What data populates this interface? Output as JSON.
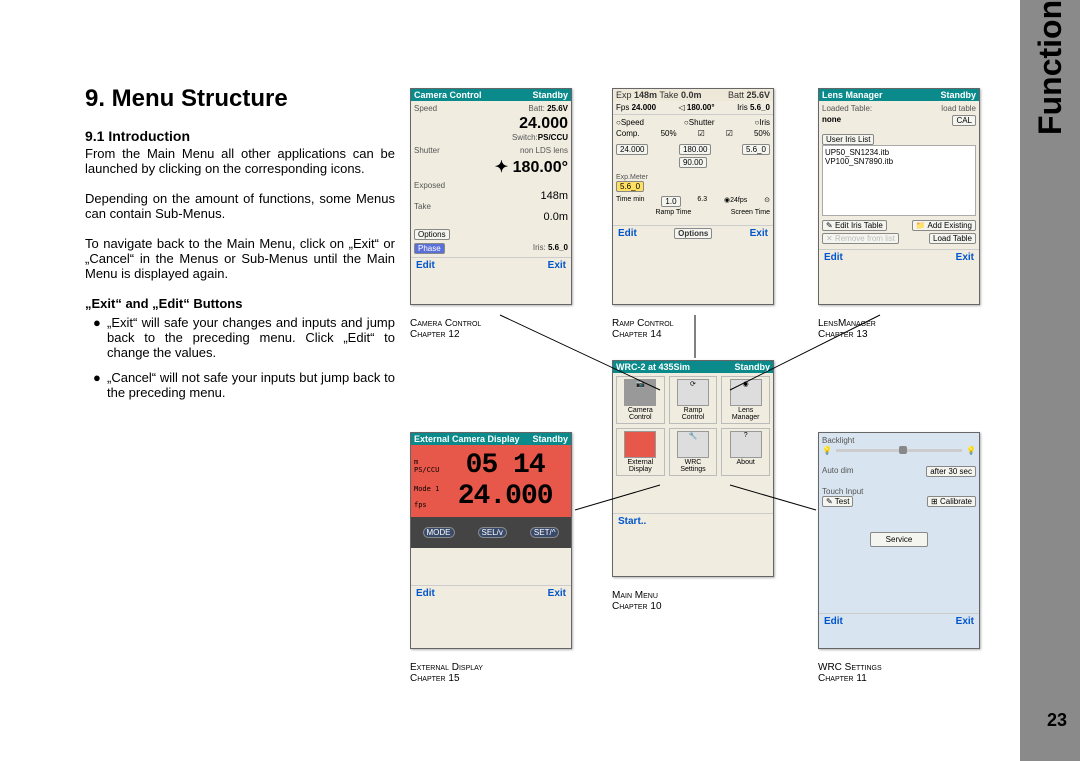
{
  "tab_label": "Functions",
  "page_number": "23",
  "heading": "9. Menu Structure",
  "sub_heading": "9.1 Introduction",
  "p1": "From the Main Menu all other applications can be launched by clicking on the corresponding icons.",
  "p2": "Depending on the amount of functions, some Menus can contain Sub-Menus.",
  "p3": "To navigate back to the Main Menu, click on „Exit“ or „Cancel“ in the Menus or Sub-Menus until the Main Menu is displayed again.",
  "sub2": "„Exit“ and „Edit“ Buttons",
  "b1": "„Exit“ will  safe your changes and inputs and jump back to the preceding menu. Click „Edit“ to change the values.",
  "b2": "„Cancel“ will not safe your inputs but jump back to the preceding menu.",
  "cam": {
    "title": "Camera Control",
    "status": "Standby",
    "speed": "Speed",
    "speed_v": "24.000",
    "batt": "Batt:",
    "batt_v": "25.6V",
    "switch": "Switch:",
    "switch_v": "PS/CCU",
    "shutter": "Shutter",
    "shutter_v": "180.00°",
    "lds": "non LDS lens",
    "exposed": "Exposed",
    "exp_v": "148m",
    "take": "Take",
    "take_v": "0.0m",
    "options": "Options",
    "phase": "Phase",
    "iris": "Iris:",
    "iris_v": "5.6_0",
    "edit": "Edit",
    "exit": "Exit",
    "cap1": "Camera Control",
    "cap2": "Chapter 12"
  },
  "ramp": {
    "title_l": "Exp",
    "v1": "148m",
    "title_m": "Take",
    "v2": "0.0m",
    "title_r": "Batt",
    "v3": "25.6V",
    "fps": "Fps",
    "fps_v": "24.000",
    "ang": "180.00°",
    "iris": "Iris",
    "iris_v": "5.6_0",
    "speed": "Speed",
    "shutter": "Shutter",
    "iris2": "Iris",
    "comp": "Comp.",
    "comp_v": "50%",
    "comp2": "50%",
    "r1": "24.000",
    "r2": "180.00",
    "r3": "5.6_0",
    "r4": "90.00",
    "exp_m": "Exp.Meter",
    "exp_mv": "5.6_0",
    "tmin": "Time min",
    "tv": "1.0",
    "rv": "6.3",
    "fv": "24fps",
    "rt": "Ramp Time",
    "st": "Screen Time",
    "edit": "Edit",
    "opt": "Options",
    "exit": "Exit",
    "cap1": "Ramp Control",
    "cap2": "Chapter 14"
  },
  "lens": {
    "title": "Lens Manager",
    "status": "Standby",
    "lt": "Loaded Table:",
    "none": "none",
    "load": "load table",
    "cal": "CAL",
    "uil": "User Iris List",
    "f1": "UP50_SN1234.itb",
    "f2": "VP100_SN7890.itb",
    "b1": "Edit Iris Table",
    "b2": "Add Existing",
    "b3": "Remove from list",
    "b4": "Load Table",
    "edit": "Edit",
    "exit": "Exit",
    "cap1": "LensManager",
    "cap2": "Chapter 13"
  },
  "main": {
    "title": "WRC-2 at 435Sim",
    "status": "Standby",
    "c1": "Camera Control",
    "c2": "Ramp Control",
    "c3": "Lens Manager",
    "c4": "External Display",
    "c5": "WRC Settings",
    "c6": "About",
    "start": "Start..",
    "cap1": "Main Menu",
    "cap2": "Chapter 10"
  },
  "ext": {
    "title": "External Camera Display",
    "status": "Standby",
    "m": "m",
    "ps": "PS/CCU",
    "mode1": "Mode 1",
    "fps": "fps",
    "d1": "05 14",
    "d2": "24.000",
    "b1": "MODE",
    "b2": "SEL/v",
    "b3": "SET/^",
    "edit": "Edit",
    "exit": "Exit",
    "cap1": "External Display",
    "cap2": "Chapter 15"
  },
  "wrc": {
    "bl": "Backlight",
    "ad": "Auto dim",
    "adv": "after 30 sec",
    "ti": "Touch Input",
    "test": "Test",
    "cal": "Calibrate",
    "srv": "Service",
    "edit": "Edit",
    "exit": "Exit",
    "cap1": "WRC Settings",
    "cap2": "Chapter 11"
  }
}
